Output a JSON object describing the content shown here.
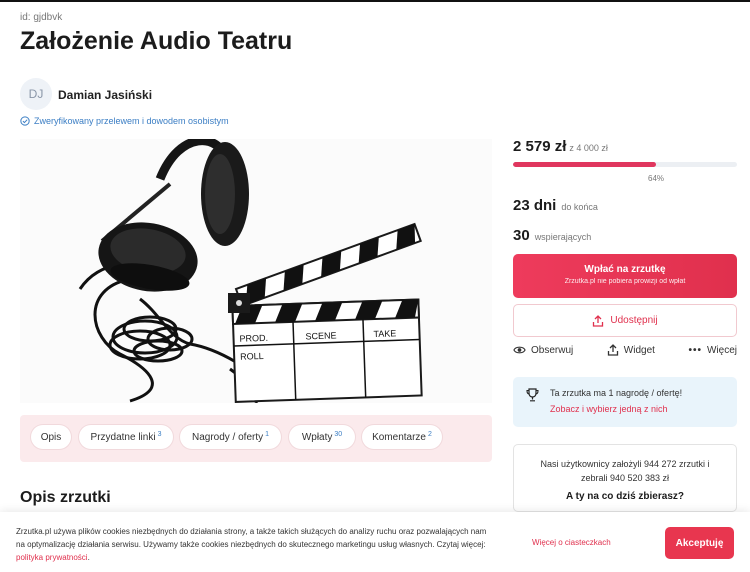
{
  "campaign_id": "id: gjdbvk",
  "title": "Założenie Audio Teatru",
  "author": {
    "initials": "DJ",
    "name": "Damian Jasiński",
    "verified": "Zweryfikowany przelewem i dowodem osobistym"
  },
  "tabs": [
    {
      "label": "Opis",
      "count": ""
    },
    {
      "label": "Przydatne linki",
      "count": "3"
    },
    {
      "label": "Nagrody / oferty",
      "count": "1"
    },
    {
      "label": "Wpłaty",
      "count": "30"
    },
    {
      "label": "Komentarze",
      "count": "2"
    }
  ],
  "section_title": "Opis zrzutki",
  "funding": {
    "raised": "2 579 zł",
    "goal": "z 4 000 zł",
    "percent": 64,
    "percent_label": "64%",
    "days": "23 dni",
    "days_label": "do końca",
    "backers": "30",
    "backers_label": "wspierających"
  },
  "donate": {
    "label": "Wpłać na zrzutkę",
    "sublabel": "Zrzutka.pl nie pobiera prowizji od wpłat"
  },
  "share_label": "Udostępnij",
  "actions": {
    "observe": "Obserwuj",
    "widget": "Widget",
    "more": "Więcej"
  },
  "reward": {
    "line1": "Ta zrzutka ma 1 nagrodę / ofertę!",
    "line2": "Zobacz i wybierz jedną z nich"
  },
  "stats": {
    "line1": "Nasi użytkownicy założyli 944 272 zrzutki i zebrali 940 520 383 zł",
    "line2": "A ty na co dziś zbierasz?"
  },
  "cookie": {
    "text": "Zrzutka.pl używa plików cookies niezbędnych do działania strony, a także takich służących do analizy ruchu oraz pozwalających nam na optymalizację działania serwisu. Używamy także cookies niezbędnych do skutecznego marketingu usług własnych. Czytaj więcej: ",
    "link": "polityka prywatności",
    "more": "Więcej o ciasteczkach",
    "accept": "Akceptuję"
  },
  "hero_image": {
    "clapper_text_1": "PROD.",
    "clapper_text_2": "SCENE",
    "clapper_text_3": "TAKE",
    "clapper_text_4": "ROLL"
  },
  "colors": {
    "accent": "#e0304d",
    "link": "#3b7ec4",
    "tabs_bg": "#fbeaec",
    "reward_bg": "#e9f4fb"
  }
}
